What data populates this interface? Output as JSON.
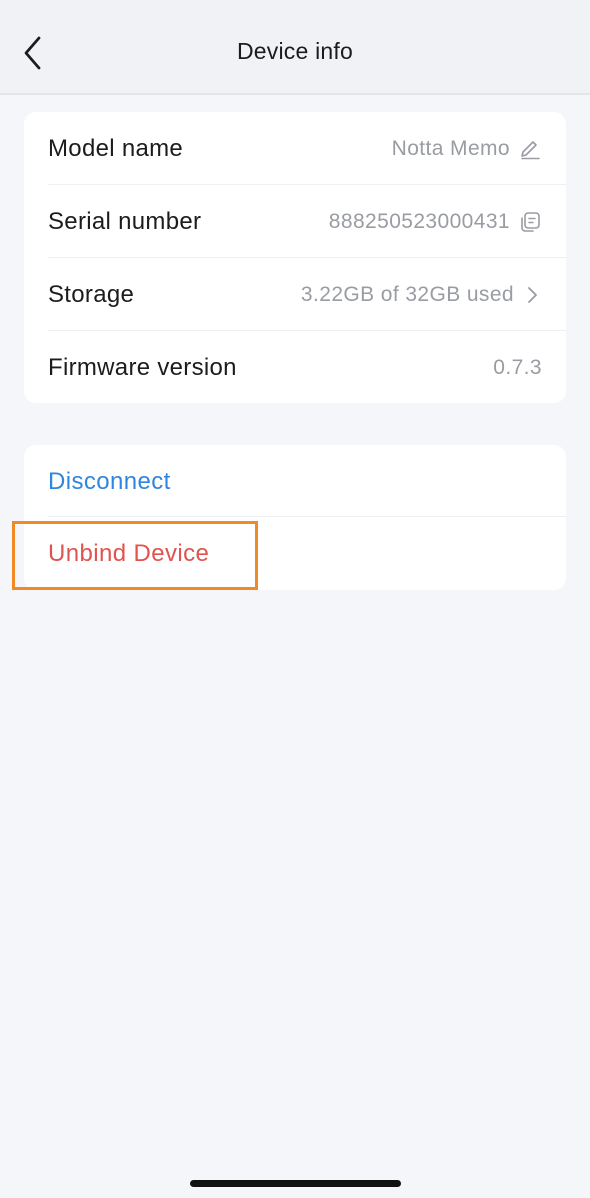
{
  "header": {
    "title": "Device info",
    "back_icon": "chevron-left-icon"
  },
  "info": {
    "model": {
      "label": "Model name",
      "value": "Notta Memo",
      "icon": "pencil-icon"
    },
    "serial": {
      "label": "Serial number",
      "value": "888250523000431",
      "icon": "copy-icon"
    },
    "storage": {
      "label": "Storage",
      "value": "3.22GB of 32GB used",
      "icon": "chevron-right-icon"
    },
    "firmware": {
      "label": "Firmware version",
      "value": "0.7.3"
    }
  },
  "actions": {
    "disconnect": {
      "label": "Disconnect",
      "color": "#2f86e0"
    },
    "unbind": {
      "label": "Unbind Device",
      "color": "#e0534f"
    }
  },
  "colors": {
    "highlight": "#f08a24",
    "background": "#f4f6fa"
  }
}
